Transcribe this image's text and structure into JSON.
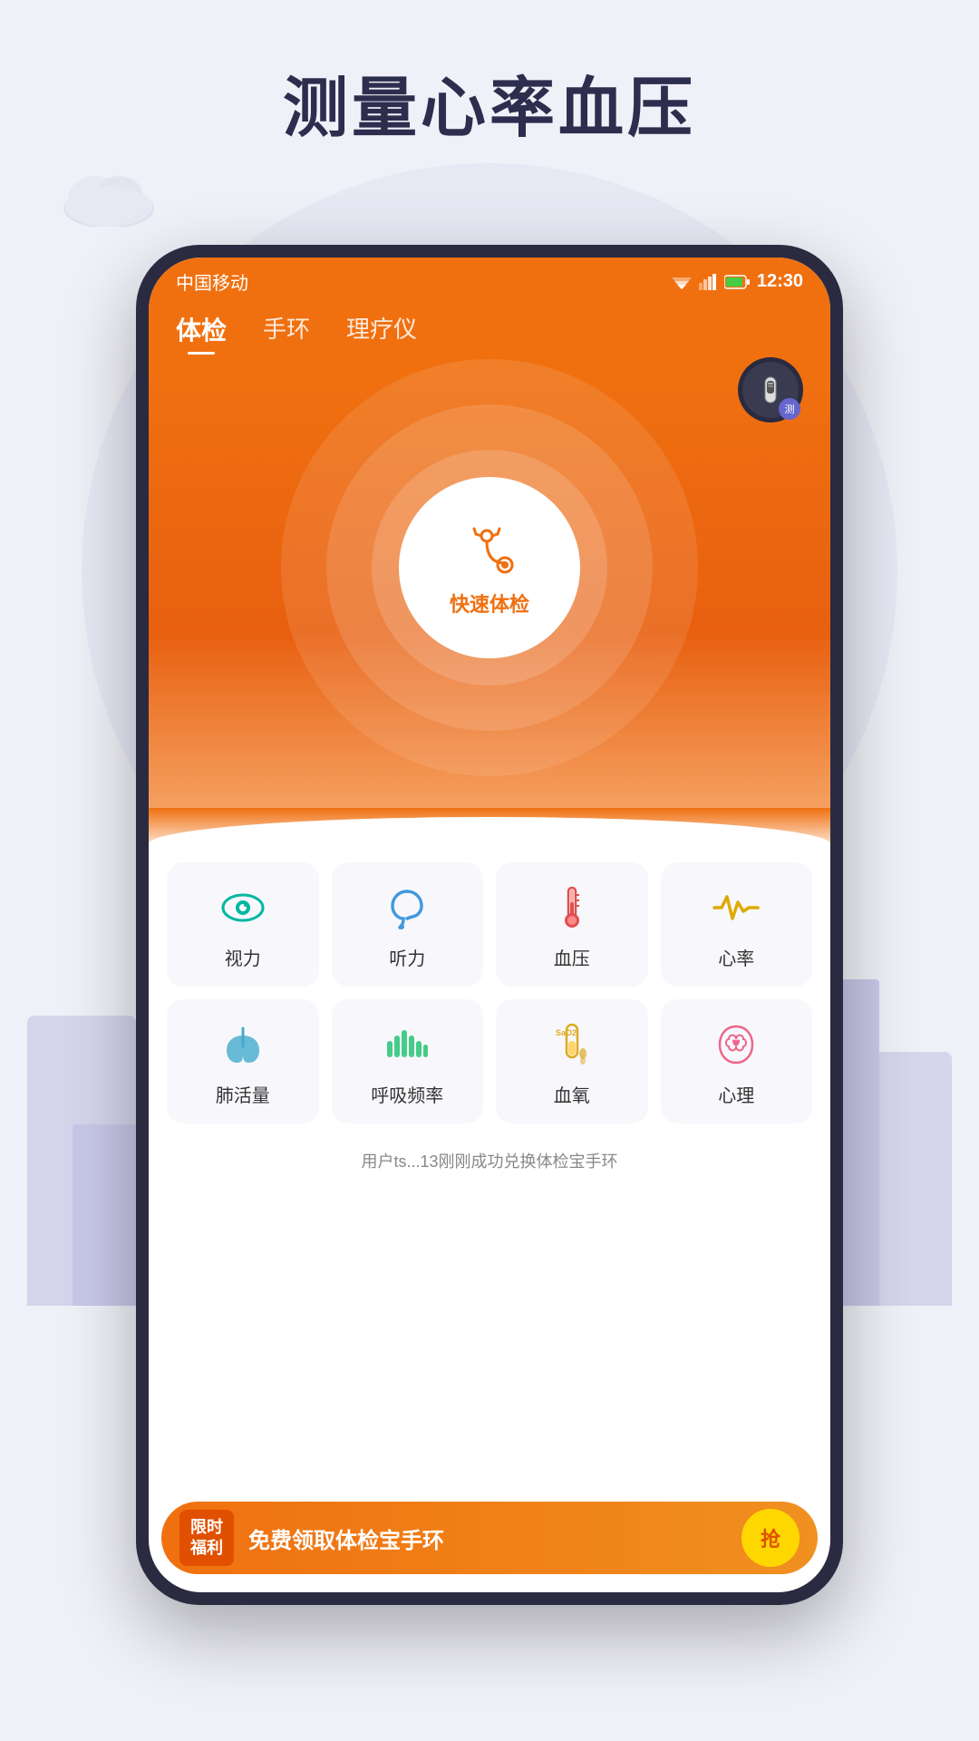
{
  "page": {
    "title": "测量心率血压",
    "background_color": "#f0f0f8"
  },
  "status_bar": {
    "carrier": "中国移动",
    "time": "12:30"
  },
  "tabs": [
    {
      "id": "physical",
      "label": "体检",
      "active": true
    },
    {
      "id": "band",
      "label": "手环",
      "active": false
    },
    {
      "id": "therapy",
      "label": "理疗仪",
      "active": false
    }
  ],
  "device_badge": {
    "label": "测"
  },
  "center_button": {
    "label": "快速体检"
  },
  "grid_items_row1": [
    {
      "id": "vision",
      "label": "视力",
      "icon": "eye"
    },
    {
      "id": "hearing",
      "label": "听力",
      "icon": "ear"
    },
    {
      "id": "blood_pressure",
      "label": "血压",
      "icon": "thermometer"
    },
    {
      "id": "heart_rate",
      "label": "心率",
      "icon": "heartrate"
    }
  ],
  "grid_items_row2": [
    {
      "id": "lung",
      "label": "肺活量",
      "icon": "lung"
    },
    {
      "id": "breathing",
      "label": "呼吸频率",
      "icon": "wave"
    },
    {
      "id": "blood_oxygen",
      "label": "血氧",
      "icon": "sao2"
    },
    {
      "id": "psychology",
      "label": "心理",
      "icon": "brain"
    }
  ],
  "notification": {
    "text": "用户ts...13刚刚成功兑换体检宝手环"
  },
  "banner": {
    "tag_line1": "限时",
    "tag_line2": "福利",
    "text": "免费领取体检宝手环",
    "button_label": "抢"
  }
}
